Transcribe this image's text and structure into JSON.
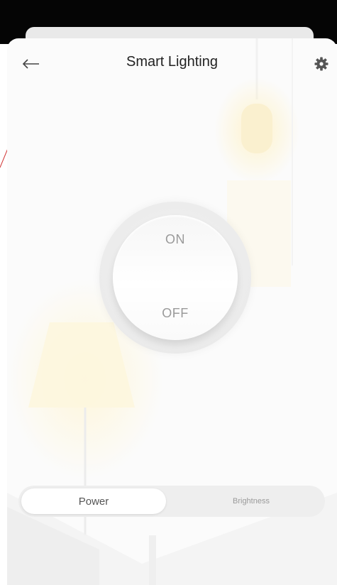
{
  "header": {
    "title": "Smart Lighting",
    "back_icon": "arrow-left-icon",
    "settings_icon": "gear-icon"
  },
  "power_switch": {
    "on_label": "ON",
    "off_label": "OFF"
  },
  "tabs": [
    {
      "label": "Power",
      "selected": true
    },
    {
      "label": "Brightness",
      "selected": false
    }
  ],
  "colors": {
    "status_bar": "#050505",
    "background": "#fbfbfb",
    "lamp_glow": "#fff3c4",
    "text": "#222222",
    "muted_text": "#9a9a9a"
  }
}
